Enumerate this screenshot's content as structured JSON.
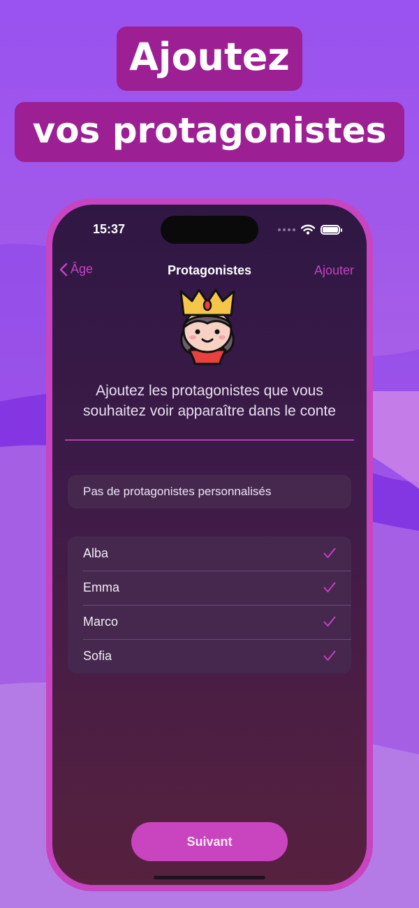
{
  "headline": {
    "line1": "Ajoutez",
    "line2": "vos protagonistes"
  },
  "status_bar": {
    "time": "15:37"
  },
  "nav": {
    "back_label": "Âge",
    "title": "Protagonistes",
    "add_label": "Ajouter"
  },
  "instruction": "Ajoutez les protagonistes que vous souhaitez voir apparaître dans le conte",
  "no_custom_protagonists": "Pas de protagonistes personnalisés",
  "protagonists": [
    {
      "name": "Alba",
      "selected": true
    },
    {
      "name": "Emma",
      "selected": true
    },
    {
      "name": "Marco",
      "selected": true
    },
    {
      "name": "Sofia",
      "selected": true
    }
  ],
  "next_button_label": "Suivant",
  "colors": {
    "accent": "#c541c0",
    "headline_pill": "#9d1f94",
    "screen_top": "#2f1744",
    "screen_bottom": "#57213f"
  },
  "icons": {
    "back": "chevron-left-icon",
    "selected": "checkmark-icon",
    "avatar": "princess-icon",
    "wifi": "wifi-icon",
    "battery": "battery-icon",
    "signal": "cellular-signal-icon"
  }
}
